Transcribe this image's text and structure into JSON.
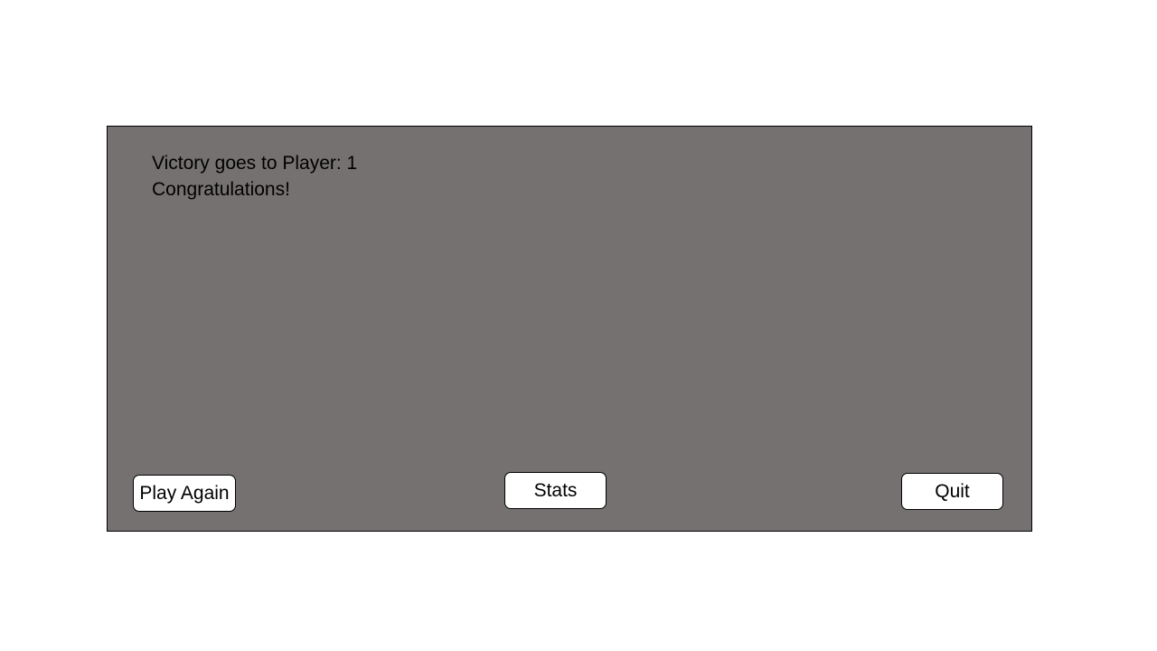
{
  "dialog": {
    "victory_line": "Victory goes to Player: 1",
    "congrats_line": "Congratulations!",
    "background_color": "#767171"
  },
  "buttons": {
    "play_again": "Play Again",
    "stats": "Stats",
    "quit": "Quit"
  }
}
